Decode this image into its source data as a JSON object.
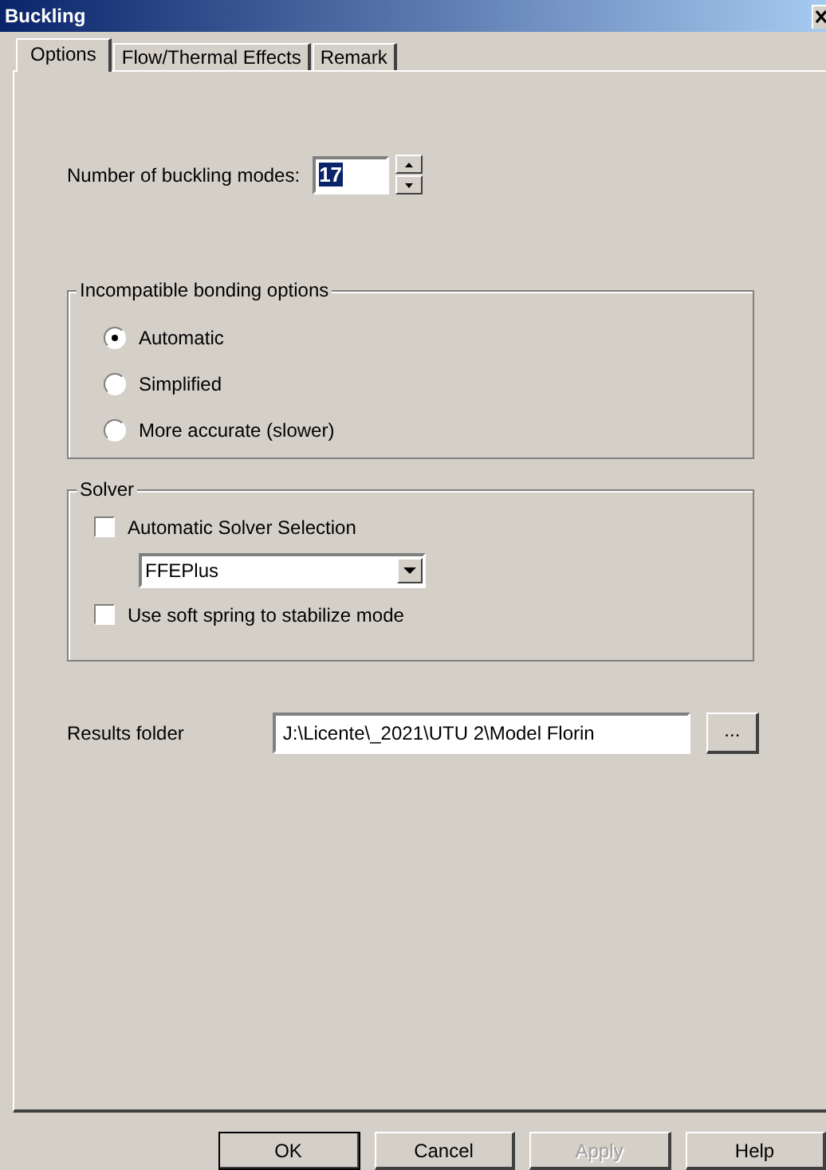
{
  "window": {
    "title": "Buckling"
  },
  "tabs": [
    {
      "label": "Options",
      "selected": true
    },
    {
      "label": "Flow/Thermal Effects",
      "selected": false
    },
    {
      "label": "Remark",
      "selected": false
    }
  ],
  "buckling_modes": {
    "label": "Number of buckling modes:",
    "value": "17"
  },
  "bonding": {
    "title": "Incompatible bonding options",
    "options": [
      {
        "label": "Automatic",
        "selected": true
      },
      {
        "label": "Simplified",
        "selected": false
      },
      {
        "label": "More accurate (slower)",
        "selected": false
      }
    ]
  },
  "solver": {
    "title": "Solver",
    "automatic_selection": {
      "label": "Automatic Solver Selection",
      "checked": false
    },
    "solver_choice": {
      "value": "FFEPlus"
    },
    "soft_spring": {
      "label": "Use soft spring to stabilize mode",
      "checked": false
    }
  },
  "results_folder": {
    "label": "Results folder",
    "value": "J:\\Licente\\_2021\\UTU 2\\Model Florin",
    "browse": "..."
  },
  "buttons": [
    {
      "label": "OK",
      "disabled": false,
      "default": true
    },
    {
      "label": "Cancel",
      "disabled": false,
      "default": false
    },
    {
      "label": "Apply",
      "disabled": true,
      "default": false
    },
    {
      "label": "Help",
      "disabled": false,
      "default": false
    }
  ]
}
